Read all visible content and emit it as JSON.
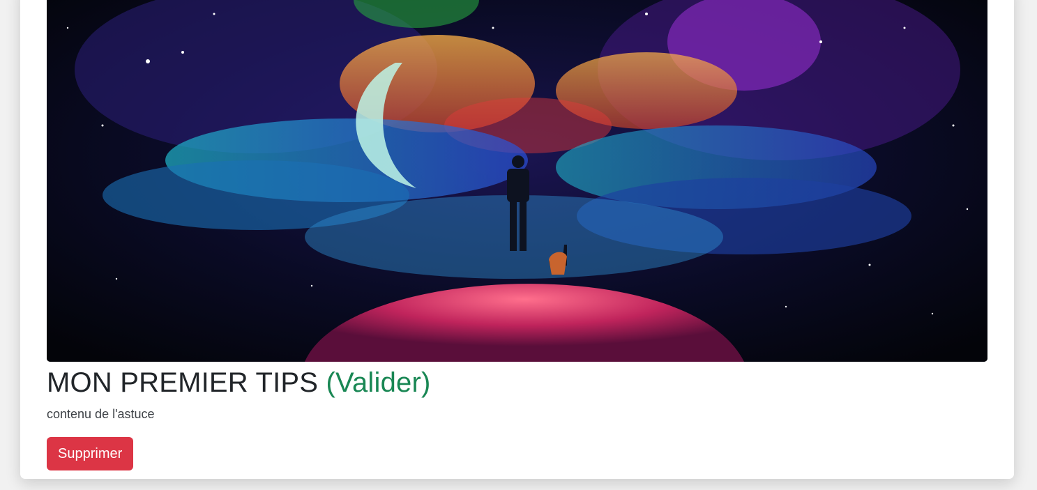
{
  "tip": {
    "title": "MON PREMIER TIPS",
    "status": "(Valider)",
    "content": "contenu de l'astuce",
    "delete_label": "Supprimer"
  },
  "colors": {
    "status": "#198754",
    "danger": "#dc3545",
    "card_bg": "#ffffff",
    "page_bg": "#f1f1f1"
  }
}
